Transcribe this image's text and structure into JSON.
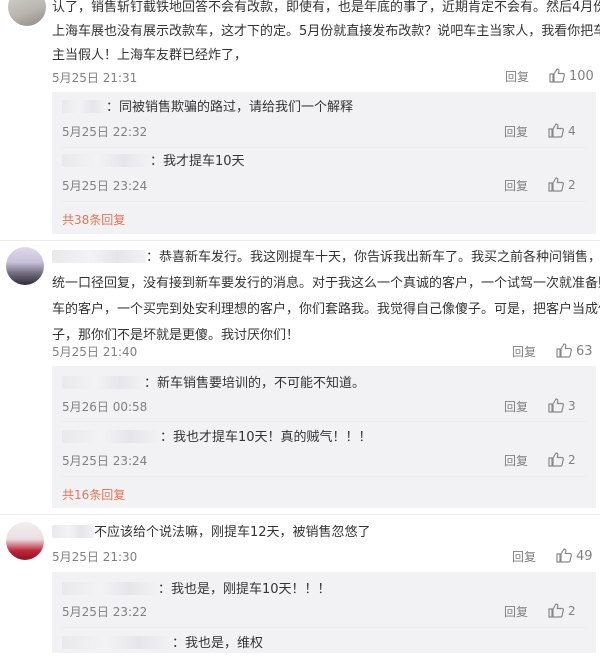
{
  "colors": {
    "link": "#eb7350",
    "meta": "#808080",
    "text": "#333333",
    "sub_bg": "#f2f2f5"
  },
  "icons": {
    "like": "thumbs-up-icon"
  },
  "comments": [
    {
      "lines": [
        "认了，销售斩钉截铁地回答不会有改款，即使有，也是年底的事了，近期肯定不会有。然后4月份",
        "上海车展也没有展示改款车，这才下的定。5月份就直接发布改款？说吧车主当家人，我看你把车",
        "主当假人！上海车友群已经炸了，"
      ],
      "time": "5月25日 21:31",
      "reply": "回复",
      "likes": "100",
      "replies": [
        {
          "text": "：同被销售欺骗的路过，请给我们一个解释",
          "time": "5月25日 22:32",
          "reply": "回复",
          "likes": "4"
        },
        {
          "text": "：我才提车10天",
          "time": "5月25日 23:24",
          "reply": "回复",
          "likes": "2"
        }
      ],
      "more": "共38条回复"
    },
    {
      "lines": [
        "：恭喜新车发行。我这刚提车十天，你告诉我出新车了。我买之前各种问销售，",
        "统一口径回复，没有接到新车要发行的消息。对于我这么一个真诚的客户，一个试驾一次就准备购",
        "车的客户，一个买完到处安利理想的客户，你们套路我。我觉得自己像傻子。可是，把客户当成傻",
        "子，那你们不是坏就是更傻。我讨厌你们！"
      ],
      "time": "5月25日 21:40",
      "reply": "回复",
      "likes": "63",
      "replies": [
        {
          "text": "：新车销售要培训的，不可能不知道。",
          "time": "5月26日 00:58",
          "reply": "回复",
          "likes": "3"
        },
        {
          "text": "：我也才提车10天！真的贼气！！！",
          "time": "5月25日 23:24",
          "reply": "回复",
          "likes": "2"
        }
      ],
      "more": "共16条回复"
    },
    {
      "lines": [
        "不应该给个说法嘛，刚提车12天，被销售忽悠了"
      ],
      "time": "5月25日 21:30",
      "reply": "回复",
      "likes": "49",
      "replies": [
        {
          "text": "：我也是，刚提车10天！！！",
          "time": "5月25日 23:22",
          "reply": "回复",
          "likes": "2"
        },
        {
          "text": "：我也是，维权"
        }
      ]
    }
  ]
}
